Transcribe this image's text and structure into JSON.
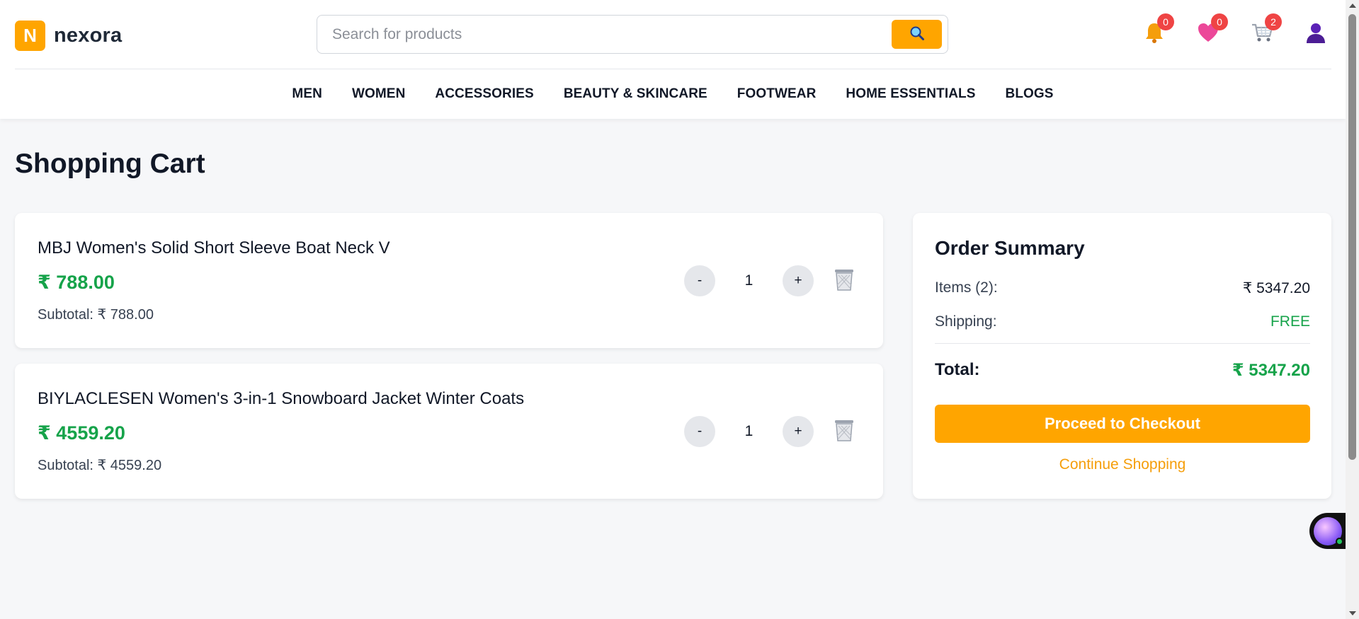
{
  "brand": {
    "logo_letter": "N",
    "name": "nexora",
    "accent": "#ffa500"
  },
  "search": {
    "placeholder": "Search for products",
    "value": ""
  },
  "header_icons": {
    "notifications": {
      "icon": "bell-icon",
      "count": "0"
    },
    "wishlist": {
      "icon": "heart-icon",
      "count": "0"
    },
    "cart": {
      "icon": "cart-icon",
      "count": "2"
    },
    "profile": {
      "icon": "user-icon"
    }
  },
  "nav": {
    "items": [
      "MEN",
      "WOMEN",
      "ACCESSORIES",
      "BEAUTY & SKINCARE",
      "FOOTWEAR",
      "HOME ESSENTIALS",
      "BLOGS"
    ]
  },
  "cart": {
    "title": "Shopping Cart",
    "items": [
      {
        "name": "MBJ Women's Solid Short Sleeve Boat Neck V",
        "price": "₹ 788.00",
        "subtotal": "Subtotal: ₹ 788.00",
        "quantity": "1",
        "minus": "-",
        "plus": "+"
      },
      {
        "name": "BIYLACLESEN Women's 3-in-1 Snowboard Jacket Winter Coats",
        "price": "₹ 4559.20",
        "subtotal": "Subtotal: ₹ 4559.20",
        "quantity": "1",
        "minus": "-",
        "plus": "+"
      }
    ]
  },
  "summary": {
    "title": "Order Summary",
    "items_label": "Items (2):",
    "items_value": "₹ 5347.20",
    "shipping_label": "Shipping:",
    "shipping_value": "FREE",
    "total_label": "Total:",
    "total_value": "₹ 5347.20",
    "checkout_label": "Proceed to Checkout",
    "continue_label": "Continue Shopping"
  },
  "colors": {
    "price_green": "#16a34a",
    "badge_red": "#ef4444",
    "link_orange": "#f59e0b"
  }
}
